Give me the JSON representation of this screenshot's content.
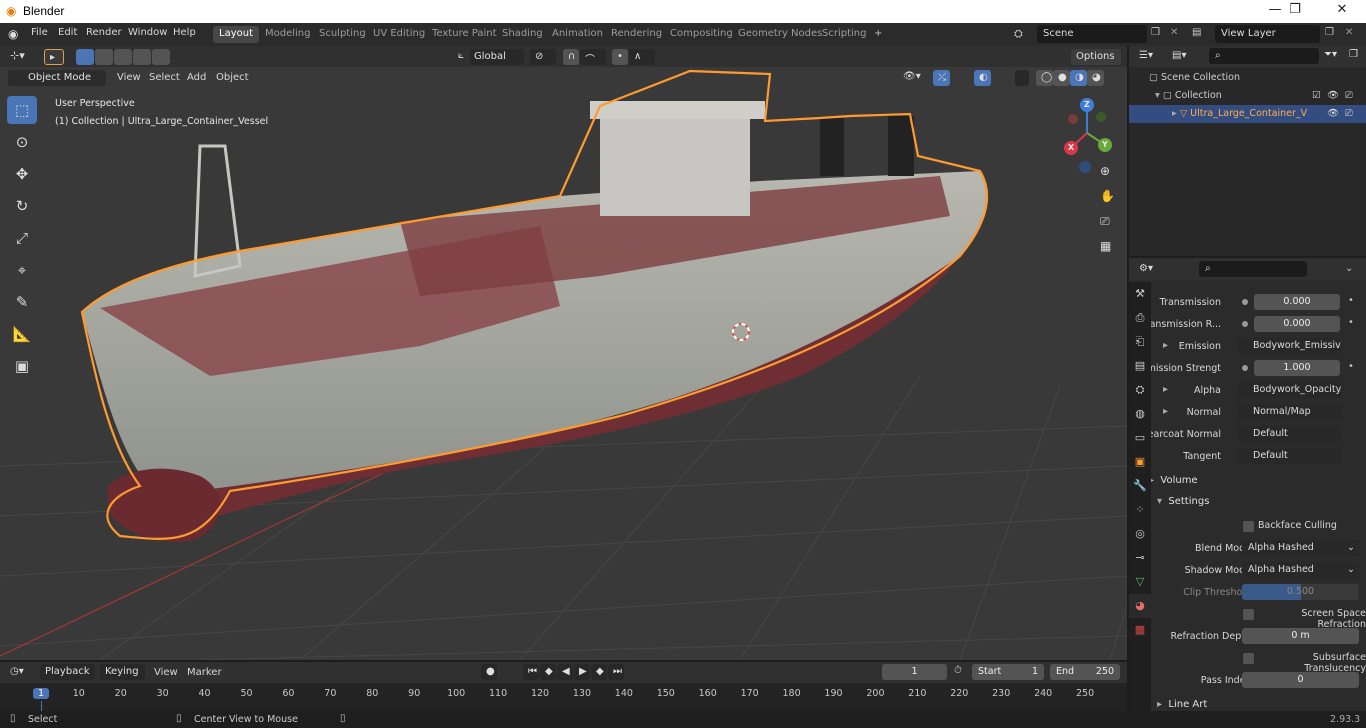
{
  "window": {
    "title": "Blender",
    "minimize": "—",
    "maximize": "❐",
    "close": "✕"
  },
  "menu": [
    "File",
    "Edit",
    "Render",
    "Window",
    "Help"
  ],
  "workspaces": [
    {
      "label": "Layout",
      "active": true
    },
    {
      "label": "Modeling"
    },
    {
      "label": "Sculpting"
    },
    {
      "label": "UV Editing"
    },
    {
      "label": "Texture Paint"
    },
    {
      "label": "Shading"
    },
    {
      "label": "Animation"
    },
    {
      "label": "Rendering"
    },
    {
      "label": "Compositing"
    },
    {
      "label": "Geometry Nodes"
    },
    {
      "label": "Scripting"
    }
  ],
  "add_workspace": "+",
  "scene": {
    "name": "Scene",
    "view_layer": "View Layer"
  },
  "header": {
    "transform_orientation": "Global",
    "options": "Options",
    "mode": "Object Mode",
    "view": "View",
    "select": "Select",
    "add": "Add",
    "object": "Object"
  },
  "viewport": {
    "perspective": "User Perspective",
    "collection_info": "(1) Collection | Ultra_Large_Container_Vessel",
    "gizmo": {
      "z": "Z",
      "y": "Y",
      "x": "X"
    }
  },
  "outliner": {
    "search_placeholder": "",
    "scene_collection": "Scene Collection",
    "collection": "Collection",
    "object": "Ultra_Large_Container_V"
  },
  "properties": {
    "rows": [
      {
        "label": "Transmission",
        "value": "0.000",
        "kind": "num"
      },
      {
        "label": "Transmission R...",
        "value": "0.000",
        "kind": "num"
      },
      {
        "label": "Emission",
        "value": "Bodywork_Emissive...",
        "kind": "link",
        "dot": "#e8d84a",
        "expand": true
      },
      {
        "label": "Emission Strengt",
        "value": "1.000",
        "kind": "num"
      },
      {
        "label": "Alpha",
        "value": "Bodywork_Opacity....",
        "kind": "link",
        "dot": "#9a9a9a",
        "expand": true
      },
      {
        "label": "Normal",
        "value": "Normal/Map",
        "kind": "link",
        "dot": "#7272d8",
        "expand": true
      },
      {
        "label": "Clearcoat Normal",
        "value": "Default",
        "kind": "link",
        "dot": "#7272d8"
      },
      {
        "label": "Tangent",
        "value": "Default",
        "kind": "link",
        "dot": "#7272d8"
      }
    ],
    "volume": "Volume",
    "settings": "Settings",
    "backface_culling": "Backface Culling",
    "blend_mode_label": "Blend Mode",
    "blend_mode": "Alpha Hashed",
    "shadow_mode_label": "Shadow Mode",
    "shadow_mode": "Alpha Hashed",
    "clip_threshold_label": "Clip Threshold",
    "clip_threshold": "0.500",
    "ssr": "Screen Space Refraction",
    "refraction_depth_label": "Refraction Depth",
    "refraction_depth": "0 m",
    "subsurface": "Subsurface Translucency",
    "pass_index_label": "Pass Index",
    "pass_index": "0",
    "line_art": "Line Art"
  },
  "timeline": {
    "playback": "Playback",
    "keying": "Keying",
    "view": "View",
    "marker": "Marker",
    "current_frame": "1",
    "start_label": "Start",
    "start": "1",
    "end_label": "End",
    "end": "250",
    "ticks": [
      "1",
      "10",
      "20",
      "30",
      "40",
      "50",
      "60",
      "70",
      "80",
      "90",
      "100",
      "110",
      "120",
      "130",
      "140",
      "150",
      "160",
      "170",
      "180",
      "190",
      "200",
      "210",
      "220",
      "230",
      "240",
      "250"
    ]
  },
  "status": {
    "select": "Select",
    "center": "Center View to Mouse",
    "version": "2.93.3"
  },
  "colors": {
    "accent": "#4a75b6",
    "selection": "#ff9a2f",
    "active_workspace": "#474747"
  }
}
